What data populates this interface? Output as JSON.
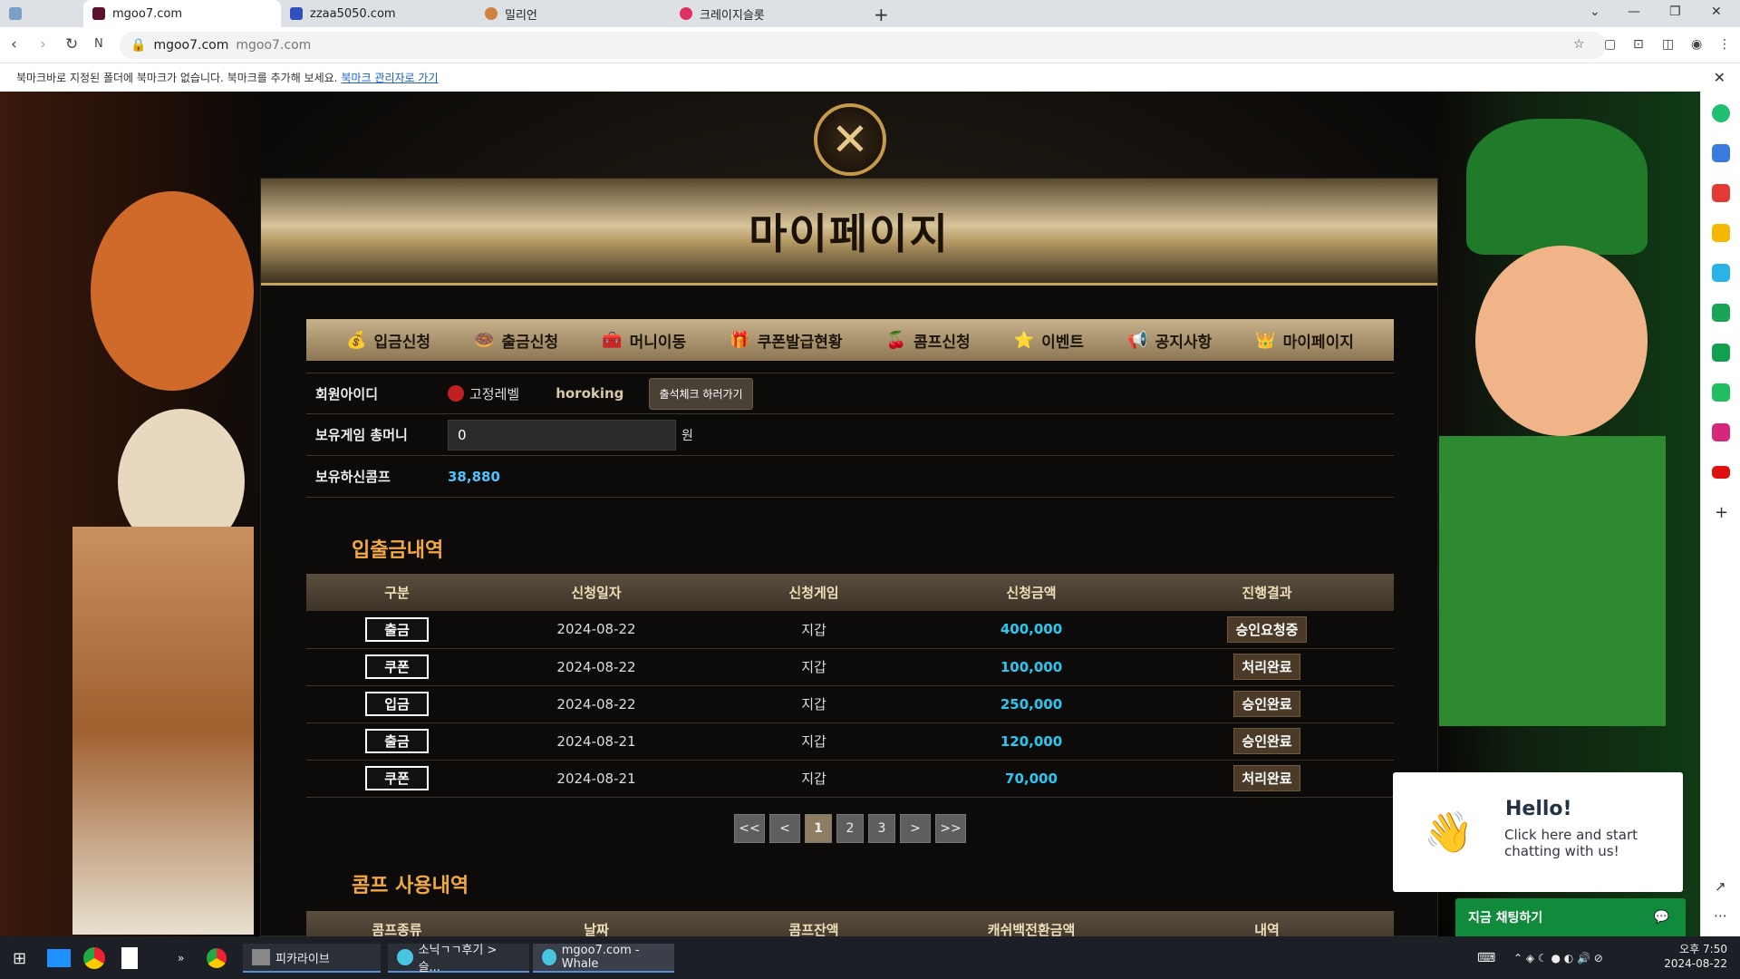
{
  "browser": {
    "tabs": [
      {
        "title": "mgoo7.com",
        "icon": "m-logo-icon",
        "color": "#5a1230",
        "active": true
      },
      {
        "title": "zzaa5050.com",
        "icon": "50-logo-icon",
        "color": "#3050c0",
        "active": false
      },
      {
        "title": "밀리언",
        "icon": "coin-icon",
        "color": "#d08040",
        "active": false
      },
      {
        "title": "크레이지슬롯",
        "icon": "heart-icon",
        "color": "#e03060",
        "active": false
      }
    ],
    "address": {
      "host": "mgoo7.com",
      "path": "mgoo7.com"
    },
    "bookmark_notice": "북마크바로 지정된 폴더에 북마크가 없습니다. 북마크를 추가해 보세요.",
    "bookmark_link": "북마크 관리자로 가기"
  },
  "modal": {
    "title": "마이페이지",
    "menu": [
      {
        "label": "입금신청",
        "icon": "money-bag-icon"
      },
      {
        "label": "출금신청",
        "icon": "donut-icon"
      },
      {
        "label": "머니이동",
        "icon": "chest-icon"
      },
      {
        "label": "쿠폰발급현황",
        "icon": "coupon-icon"
      },
      {
        "label": "콤프신청",
        "icon": "cherry-icon"
      },
      {
        "label": "이벤트",
        "icon": "star-icon"
      },
      {
        "label": "공지사항",
        "icon": "megaphone-icon"
      },
      {
        "label": "마이페이지",
        "icon": "crown-icon"
      }
    ],
    "info": {
      "member_id_label": "회원아이디",
      "level": "고정레벨",
      "username": "horoking",
      "attend_button": "출석체크 하러가기",
      "money_label": "보유게임 총머니",
      "money_value": "0",
      "money_unit": "원",
      "comp_label": "보유하신콤프",
      "comp_value": "38,880"
    },
    "history": {
      "title": "입출금내역",
      "headers": [
        "구분",
        "신청일자",
        "신청게임",
        "신청금액",
        "진행결과"
      ],
      "rows": [
        {
          "type": "출금",
          "date": "2024-08-22",
          "game": "지갑",
          "amount": "400,000",
          "result": "승인요청중"
        },
        {
          "type": "쿠폰",
          "date": "2024-08-22",
          "game": "지갑",
          "amount": "100,000",
          "result": "처리완료"
        },
        {
          "type": "입금",
          "date": "2024-08-22",
          "game": "지갑",
          "amount": "250,000",
          "result": "승인완료"
        },
        {
          "type": "출금",
          "date": "2024-08-21",
          "game": "지갑",
          "amount": "120,000",
          "result": "승인완료"
        },
        {
          "type": "쿠폰",
          "date": "2024-08-21",
          "game": "지갑",
          "amount": "70,000",
          "result": "처리완료"
        }
      ],
      "pager": {
        "first": "<<",
        "prev": "<",
        "pages": [
          "1",
          "2",
          "3"
        ],
        "next": ">",
        "last": ">>",
        "current": "1"
      }
    },
    "comp_usage": {
      "title": "콤프 사용내역",
      "headers": [
        "콤프종류",
        "날짜",
        "콤프잔액",
        "캐쉬백전환금액",
        "내역"
      ]
    }
  },
  "chat": {
    "hello": "Hello!",
    "message": "Click here and start chatting with us!",
    "bar_label": "지금 채팅하기"
  },
  "taskbar": {
    "items": [
      "피카라이브",
      "소닉ㄱㄱ후기 > 슬...",
      "mgoo7.com - Whale"
    ],
    "time": "오후 7:50",
    "date": "2024-08-22"
  }
}
